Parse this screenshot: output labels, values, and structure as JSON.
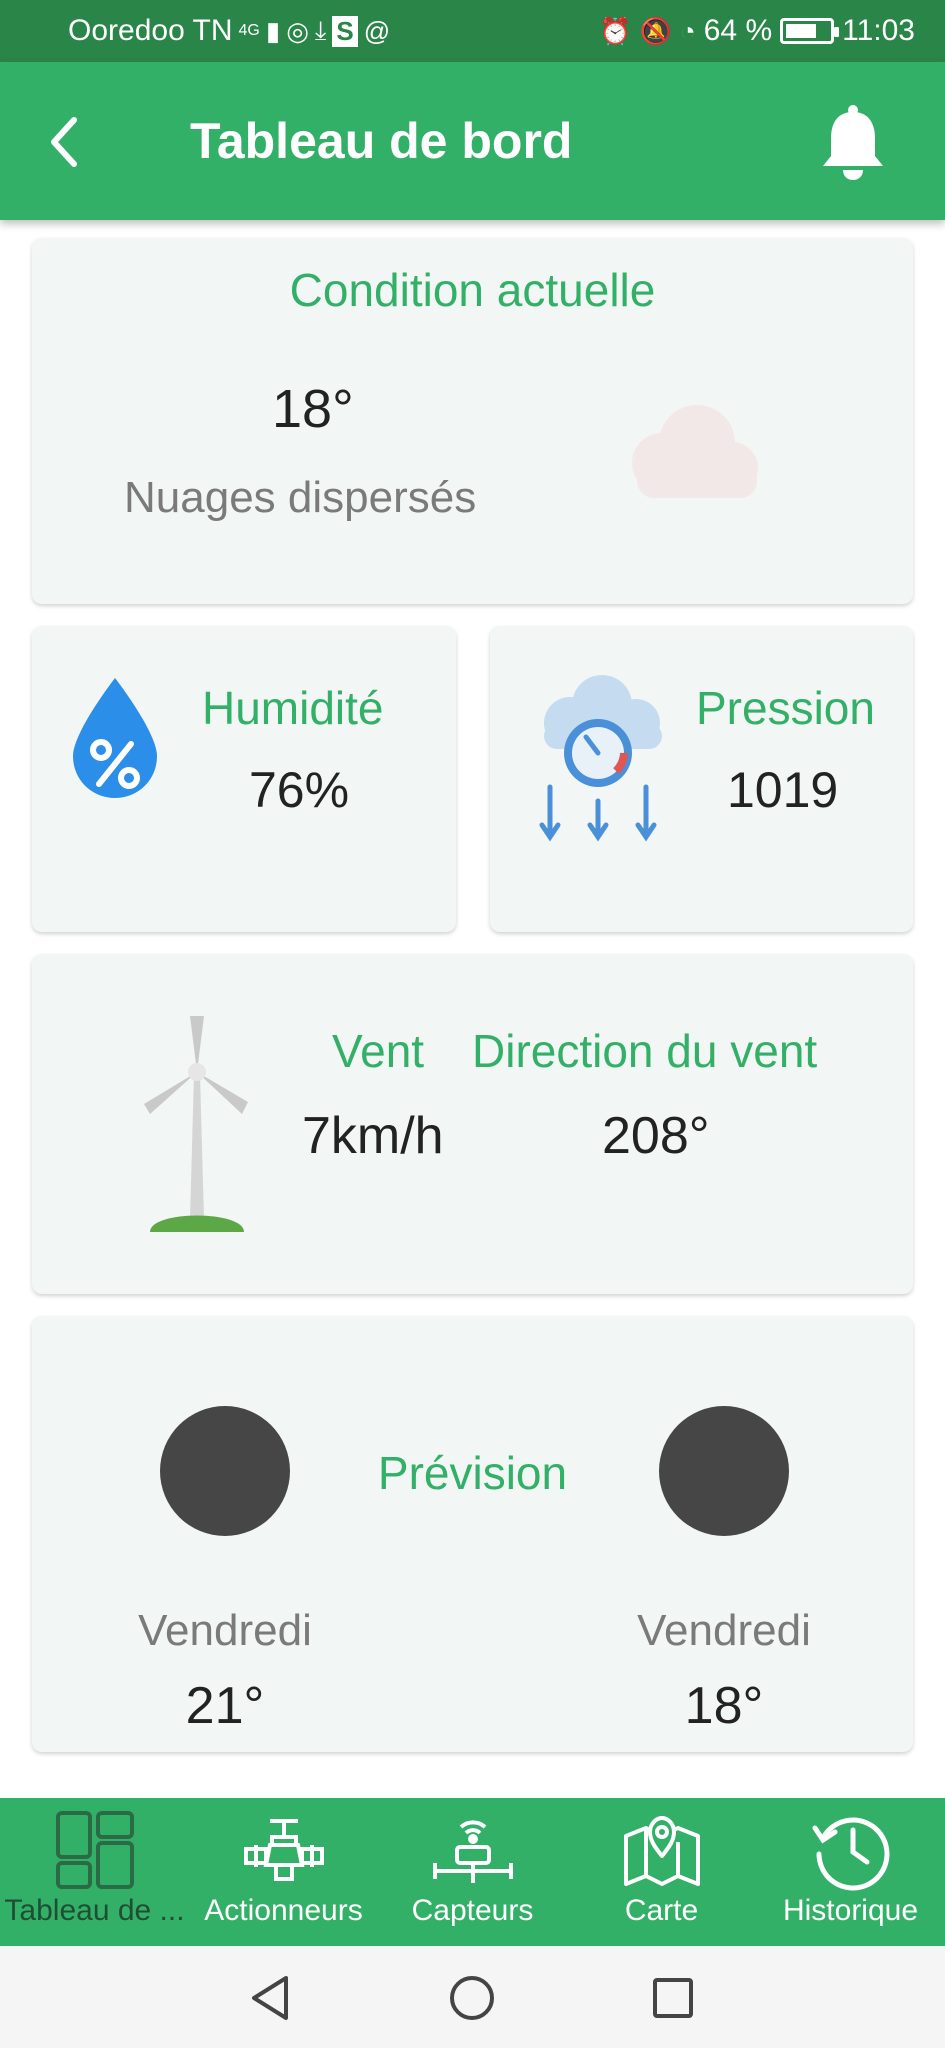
{
  "status_bar": {
    "carrier": "Ooredoo TN",
    "network": "4G",
    "battery": "64 %",
    "time": "11:03"
  },
  "header": {
    "title": "Tableau de bord",
    "back_icon": "chevron-left-icon",
    "notification_icon": "bell-icon"
  },
  "current": {
    "title": "Condition actuelle",
    "temperature": "18°",
    "description": "Nuages dispersés",
    "icon": "cloud-icon"
  },
  "humidity": {
    "label": "Humidité",
    "value": "76%",
    "icon": "humidity-drop-icon"
  },
  "pressure": {
    "label": "Pression",
    "value": "1019",
    "icon": "pressure-gauge-icon"
  },
  "wind": {
    "speed_label": "Vent",
    "direction_label": "Direction du vent",
    "speed": "7km/h",
    "direction": "208°",
    "icon": "wind-turbine-icon"
  },
  "forecast": {
    "title": "Prévision",
    "days": [
      {
        "day": "Vendredi",
        "temperature": "21°"
      },
      {
        "day": "Vendredi",
        "temperature": "18°"
      }
    ]
  },
  "bottom_nav": {
    "items": [
      {
        "label": "Tableau de ...",
        "icon": "dashboard-grid-icon"
      },
      {
        "label": "Actionneurs",
        "icon": "valve-icon"
      },
      {
        "label": "Capteurs",
        "icon": "sensor-icon"
      },
      {
        "label": "Carte",
        "icon": "map-icon"
      },
      {
        "label": "Historique",
        "icon": "history-icon"
      }
    ]
  },
  "colors": {
    "primary": "#33b068",
    "status_bar": "#2a8548",
    "card_background": "#f2f6f4",
    "forecast_circle": "#464646"
  }
}
